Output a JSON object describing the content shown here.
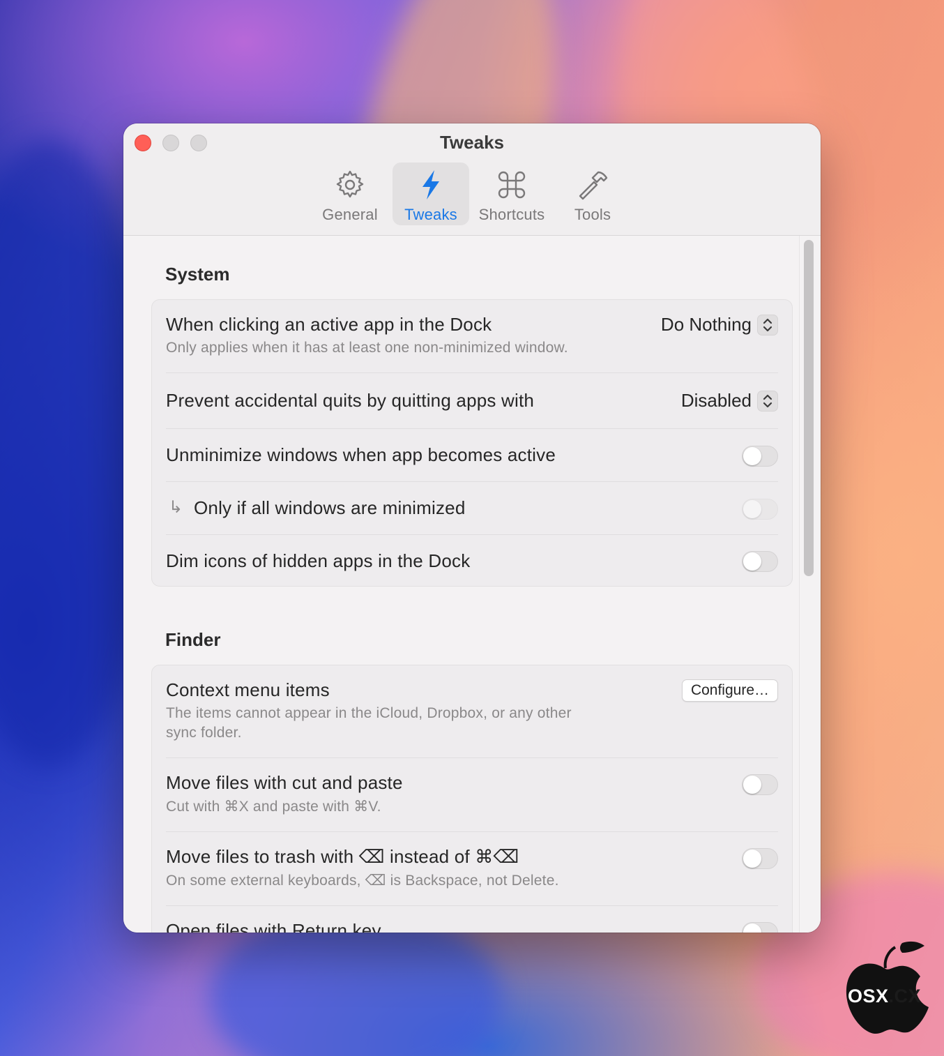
{
  "window": {
    "title": "Tweaks"
  },
  "toolbar": {
    "tabs": [
      {
        "label": "General",
        "icon": "gear-icon",
        "active": false
      },
      {
        "label": "Tweaks",
        "icon": "bolt-icon",
        "active": true
      },
      {
        "label": "Shortcuts",
        "icon": "command-icon",
        "active": false
      },
      {
        "label": "Tools",
        "icon": "hammer-icon",
        "active": false
      }
    ]
  },
  "colors": {
    "accent": "#1a78e6",
    "close": "#ff5f57"
  },
  "system": {
    "title": "System",
    "rows": [
      {
        "title": "When clicking an active app in the Dock",
        "subtitle": "Only applies when it has at least one non-minimized window.",
        "control": "popup",
        "value": "Do Nothing"
      },
      {
        "title": "Prevent accidental quits by quitting apps with",
        "control": "popup",
        "value": "Disabled"
      },
      {
        "title": "Unminimize windows when app becomes active",
        "control": "toggle",
        "on": false
      },
      {
        "title": "Only if all windows are minimized",
        "indent_icon": "↳",
        "control": "toggle",
        "on": false,
        "disabled": true
      },
      {
        "title": "Dim icons of hidden apps in the Dock",
        "control": "toggle",
        "on": false
      }
    ]
  },
  "finder": {
    "title": "Finder",
    "rows": [
      {
        "title": "Context menu items",
        "subtitle_line1": "The items cannot appear in the iCloud, Dropbox, or any other",
        "subtitle_line2": "sync folder.",
        "control": "button",
        "button_label": "Configure…"
      },
      {
        "title": "Move files with cut and paste",
        "subtitle": "Cut with ⌘X and paste with ⌘V.",
        "control": "toggle",
        "on": false
      },
      {
        "title": "Move files to trash with ⌫ instead of ⌘⌫",
        "subtitle": "On some external keyboards, ⌫ is Backspace, not Delete.",
        "control": "toggle",
        "on": false
      },
      {
        "title": "Open files with Return key",
        "control": "toggle",
        "on": false
      }
    ]
  },
  "badge": {
    "text_a": "OSX",
    "text_b": ".CX"
  }
}
